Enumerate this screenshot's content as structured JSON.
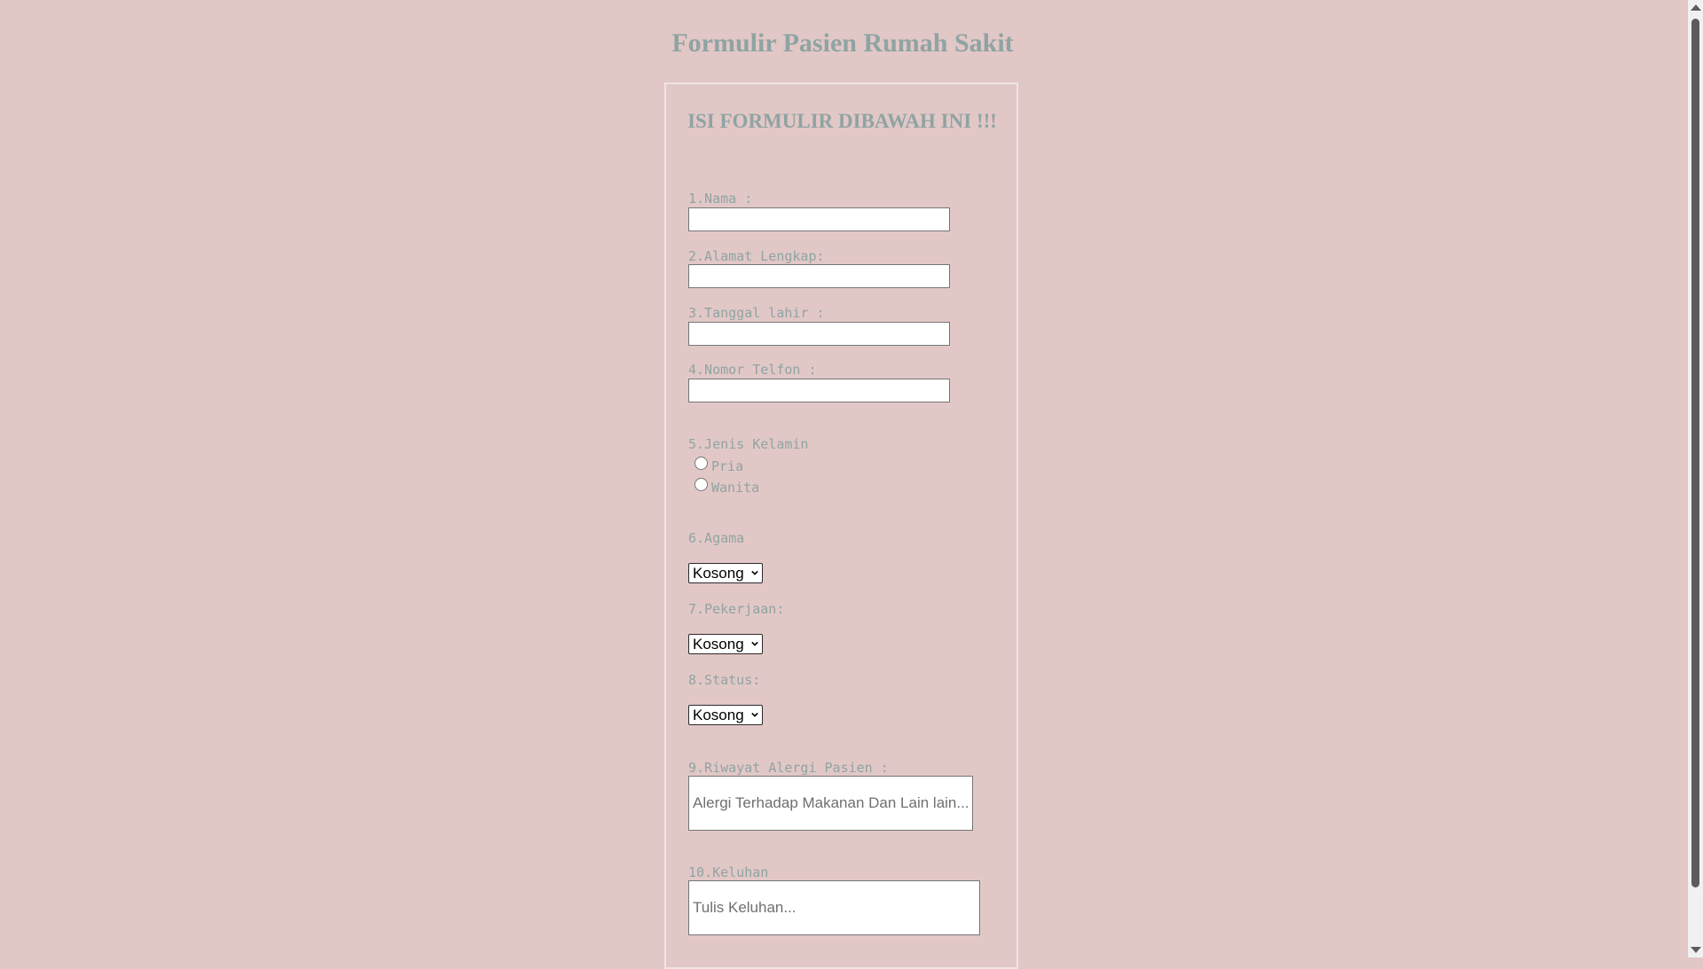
{
  "page": {
    "title": "Formulir Pasien Rumah Sakit",
    "subtitle": "ISI FORMULIR DIBAWAH INI !!!"
  },
  "fields": {
    "nama": {
      "label": "1.Nama :",
      "value": ""
    },
    "alamat": {
      "label": "2.Alamat Lengkap:",
      "value": ""
    },
    "tanggal_lahir": {
      "label": "3.Tanggal lahir :",
      "value": ""
    },
    "telfon": {
      "label": "4.Nomor Telfon :",
      "value": ""
    },
    "jenis_kelamin": {
      "label": "5.Jenis Kelamin",
      "options": [
        "Pria",
        "Wanita"
      ],
      "selected": null
    },
    "agama": {
      "label": "6.Agama",
      "selected": "Kosong"
    },
    "pekerjaan": {
      "label": "7.Pekerjaan:",
      "selected": "Kosong"
    },
    "status": {
      "label": "8.Status:",
      "selected": "Kosong"
    },
    "alergi": {
      "label": "9.Riwayat Alergi Pasien :",
      "placeholder": "Alergi Terhadap Makanan Dan Lain lain..."
    },
    "keluhan": {
      "label": "10.Keluhan",
      "placeholder": "Tulis Keluhan..."
    }
  },
  "colors": {
    "background": "#e2c7c7",
    "heading_text": "#8fa4a2",
    "label_text": "#8fa4a2"
  },
  "icons": {
    "select_arrow": "chevron-down-icon",
    "scroll_up": "scroll-up-arrow-icon",
    "scroll_down": "scroll-down-arrow-icon"
  }
}
